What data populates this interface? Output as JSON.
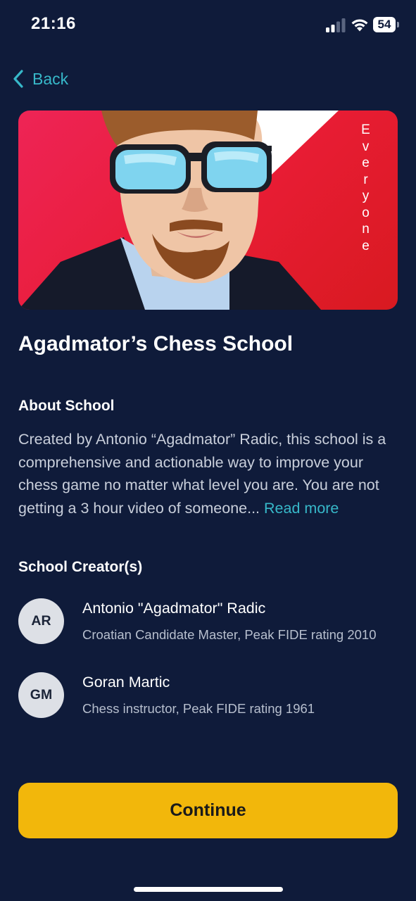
{
  "status_bar": {
    "time": "21:16",
    "battery": "54",
    "icons": [
      "cellular-signal-icon",
      "wifi-icon",
      "battery-icon"
    ]
  },
  "nav": {
    "back_label": "Back",
    "back_icon": "chevron-left-icon"
  },
  "banner": {
    "audience_label": "Everyone",
    "image": "illustrated portrait of a bearded man with blue sunglasses"
  },
  "school": {
    "title": "Agadmator’s Chess School"
  },
  "about": {
    "heading": "About School",
    "text": "Created by Antonio “Agadmator” Radic, this school is a comprehensive and actionable way to improve your chess game no matter what level you are. You are not getting a 3 hour video of someone...",
    "read_more": "Read more"
  },
  "creators": {
    "heading": "School Creator(s)",
    "items": [
      {
        "initials": "AR",
        "name": "Antonio \"Agadmator\" Radic",
        "description": "Croatian Candidate Master, Peak FIDE rating 2010"
      },
      {
        "initials": "GM",
        "name": "Goran Martic",
        "description": "Chess instructor, Peak FIDE rating 1961"
      }
    ]
  },
  "actions": {
    "continue_label": "Continue"
  },
  "colors": {
    "background": "#0f1b3a",
    "accent": "#37b8c9",
    "button": "#f2b70b",
    "banner_red": "#e81c34"
  }
}
